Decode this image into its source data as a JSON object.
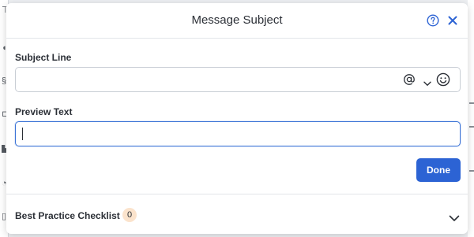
{
  "modal": {
    "title": "Message Subject",
    "help_icon": "help-circle-icon",
    "close_icon": "close-icon"
  },
  "subject": {
    "label": "Subject Line",
    "value": "",
    "placeholder": "",
    "icons": [
      "at-icon",
      "chevron-down-icon",
      "emoji-icon"
    ]
  },
  "preview": {
    "label": "Preview Text",
    "value": "",
    "placeholder": ""
  },
  "actions": {
    "done_label": "Done"
  },
  "checklist": {
    "label": "Best Practice Checklist",
    "count": "0",
    "expand_icon": "chevron-down-icon"
  },
  "colors": {
    "primary": "#2c63d4",
    "focus_border": "#3b73d6",
    "badge_bg": "#fbe3cc"
  }
}
